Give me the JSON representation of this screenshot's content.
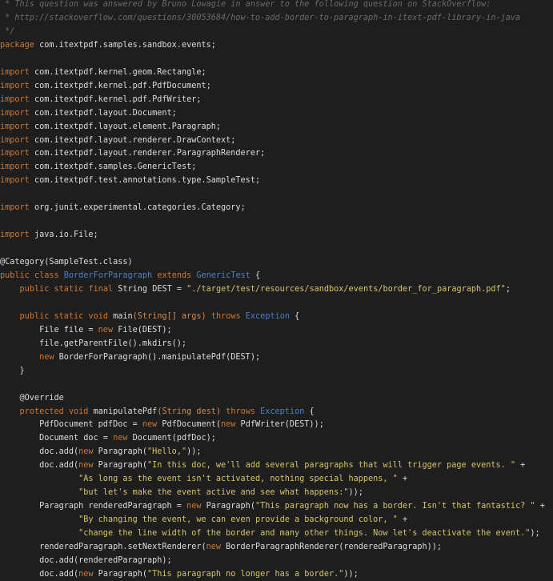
{
  "editor": {
    "lines": [
      [
        {
          "t": " * This question was answered by Bruno Lowagie in answer to the following question on StackOverflow:",
          "k": "cm"
        }
      ],
      [
        {
          "t": " * http://stackoverflow.com/questions/30053684/how-to-add-border-to-paragraph-in-itext-pdf-library-in-java",
          "k": "cm"
        }
      ],
      [
        {
          "t": " */",
          "k": "cm"
        }
      ],
      [
        {
          "t": "package",
          "k": "kw"
        },
        {
          "t": " com.itextpdf.samples.sandbox.events;",
          "k": "tx"
        }
      ],
      [],
      [
        {
          "t": "import",
          "k": "kw"
        },
        {
          "t": " com.itextpdf.kernel.geom.Rectangle;",
          "k": "tx"
        }
      ],
      [
        {
          "t": "import",
          "k": "kw"
        },
        {
          "t": " com.itextpdf.kernel.pdf.PdfDocument;",
          "k": "tx"
        }
      ],
      [
        {
          "t": "import",
          "k": "kw"
        },
        {
          "t": " com.itextpdf.kernel.pdf.PdfWriter;",
          "k": "tx"
        }
      ],
      [
        {
          "t": "import",
          "k": "kw"
        },
        {
          "t": " com.itextpdf.layout.Document;",
          "k": "tx"
        }
      ],
      [
        {
          "t": "import",
          "k": "kw"
        },
        {
          "t": " com.itextpdf.layout.element.Paragraph;",
          "k": "tx"
        }
      ],
      [
        {
          "t": "import",
          "k": "kw"
        },
        {
          "t": " com.itextpdf.layout.renderer.DrawContext;",
          "k": "tx"
        }
      ],
      [
        {
          "t": "import",
          "k": "kw"
        },
        {
          "t": " com.itextpdf.layout.renderer.ParagraphRenderer;",
          "k": "tx"
        }
      ],
      [
        {
          "t": "import",
          "k": "kw"
        },
        {
          "t": " com.itextpdf.samples.GenericTest;",
          "k": "tx"
        }
      ],
      [
        {
          "t": "import",
          "k": "kw"
        },
        {
          "t": " com.itextpdf.test.annotations.type.SampleTest;",
          "k": "tx"
        }
      ],
      [],
      [
        {
          "t": "import",
          "k": "kw"
        },
        {
          "t": " org.junit.experimental.categories.Category;",
          "k": "tx"
        }
      ],
      [],
      [
        {
          "t": "import",
          "k": "kw"
        },
        {
          "t": " java.io.File;",
          "k": "tx"
        }
      ],
      [],
      [
        {
          "t": "@Category(SampleTest.class)",
          "k": "an"
        }
      ],
      [
        {
          "t": "public",
          "k": "kw"
        },
        {
          "t": " ",
          "k": "tx"
        },
        {
          "t": "class",
          "k": "kw"
        },
        {
          "t": " ",
          "k": "tx"
        },
        {
          "t": "BorderForParagraph",
          "k": "ty"
        },
        {
          "t": " ",
          "k": "tx"
        },
        {
          "t": "extends",
          "k": "kw"
        },
        {
          "t": " ",
          "k": "tx"
        },
        {
          "t": "GenericTest",
          "k": "ty"
        },
        {
          "t": " {",
          "k": "tx"
        }
      ],
      [
        {
          "t": "    ",
          "k": "tx"
        },
        {
          "t": "public",
          "k": "kw"
        },
        {
          "t": " ",
          "k": "tx"
        },
        {
          "t": "static",
          "k": "kw"
        },
        {
          "t": " ",
          "k": "tx"
        },
        {
          "t": "final",
          "k": "kw"
        },
        {
          "t": " String DEST = ",
          "k": "tx"
        },
        {
          "t": "\"./target/test/resources/sandbox/events/border_for_paragraph.pdf\"",
          "k": "st"
        },
        {
          "t": ";",
          "k": "tx"
        }
      ],
      [],
      [
        {
          "t": "    ",
          "k": "tx"
        },
        {
          "t": "public",
          "k": "kw"
        },
        {
          "t": " ",
          "k": "tx"
        },
        {
          "t": "static",
          "k": "kw"
        },
        {
          "t": " ",
          "k": "tx"
        },
        {
          "t": "void",
          "k": "kw"
        },
        {
          "t": " main",
          "k": "tx"
        },
        {
          "t": "(String[] args)",
          "k": "pr"
        },
        {
          "t": " ",
          "k": "tx"
        },
        {
          "t": "throws",
          "k": "kw"
        },
        {
          "t": " ",
          "k": "tx"
        },
        {
          "t": "Exception",
          "k": "ty"
        },
        {
          "t": " {",
          "k": "tx"
        }
      ],
      [
        {
          "t": "        File file = ",
          "k": "tx"
        },
        {
          "t": "new",
          "k": "kw"
        },
        {
          "t": " File(DEST);",
          "k": "tx"
        }
      ],
      [
        {
          "t": "        file.getParentFile().mkdirs();",
          "k": "tx"
        }
      ],
      [
        {
          "t": "        ",
          "k": "tx"
        },
        {
          "t": "new",
          "k": "kw"
        },
        {
          "t": " BorderForParagraph().manipulatePdf(DEST);",
          "k": "tx"
        }
      ],
      [
        {
          "t": "    }",
          "k": "tx"
        }
      ],
      [],
      [
        {
          "t": "    @Override",
          "k": "an"
        }
      ],
      [
        {
          "t": "    ",
          "k": "tx"
        },
        {
          "t": "protected",
          "k": "kw"
        },
        {
          "t": " ",
          "k": "tx"
        },
        {
          "t": "void",
          "k": "kw"
        },
        {
          "t": " manipulatePdf",
          "k": "tx"
        },
        {
          "t": "(String dest)",
          "k": "pr"
        },
        {
          "t": " ",
          "k": "tx"
        },
        {
          "t": "throws",
          "k": "kw"
        },
        {
          "t": " ",
          "k": "tx"
        },
        {
          "t": "Exception",
          "k": "ty"
        },
        {
          "t": " {",
          "k": "tx"
        }
      ],
      [
        {
          "t": "        PdfDocument pdfDoc = ",
          "k": "tx"
        },
        {
          "t": "new",
          "k": "kw"
        },
        {
          "t": " PdfDocument(",
          "k": "tx"
        },
        {
          "t": "new",
          "k": "kw"
        },
        {
          "t": " PdfWriter(DEST));",
          "k": "tx"
        }
      ],
      [
        {
          "t": "        Document doc = ",
          "k": "tx"
        },
        {
          "t": "new",
          "k": "kw"
        },
        {
          "t": " Document(pdfDoc);",
          "k": "tx"
        }
      ],
      [
        {
          "t": "        doc.add(",
          "k": "tx"
        },
        {
          "t": "new",
          "k": "kw"
        },
        {
          "t": " Paragraph(",
          "k": "tx"
        },
        {
          "t": "\"Hello,\"",
          "k": "st"
        },
        {
          "t": "));",
          "k": "tx"
        }
      ],
      [
        {
          "t": "        doc.add(",
          "k": "tx"
        },
        {
          "t": "new",
          "k": "kw"
        },
        {
          "t": " Paragraph(",
          "k": "tx"
        },
        {
          "t": "\"In this doc, we'll add several paragraphs that will trigger page events. \"",
          "k": "st"
        },
        {
          "t": " +",
          "k": "tx"
        }
      ],
      [
        {
          "t": "                ",
          "k": "tx"
        },
        {
          "t": "\"As long as the event isn't activated, nothing special happens, \"",
          "k": "st"
        },
        {
          "t": " +",
          "k": "tx"
        }
      ],
      [
        {
          "t": "                ",
          "k": "tx"
        },
        {
          "t": "\"but let's make the event active and see what happens:\"",
          "k": "st"
        },
        {
          "t": "));",
          "k": "tx"
        }
      ],
      [
        {
          "t": "        Paragraph renderedParagraph = ",
          "k": "tx"
        },
        {
          "t": "new",
          "k": "kw"
        },
        {
          "t": " Paragraph(",
          "k": "tx"
        },
        {
          "t": "\"This paragraph now has a border. Isn't that fantastic? \"",
          "k": "st"
        },
        {
          "t": " +",
          "k": "tx"
        }
      ],
      [
        {
          "t": "                ",
          "k": "tx"
        },
        {
          "t": "\"By changing the event, we can even provide a background color, \"",
          "k": "st"
        },
        {
          "t": " +",
          "k": "tx"
        }
      ],
      [
        {
          "t": "                ",
          "k": "tx"
        },
        {
          "t": "\"change the line width of the border and many other things. Now let's deactivate the event.\"",
          "k": "st"
        },
        {
          "t": ");",
          "k": "tx"
        }
      ],
      [
        {
          "t": "        renderedParagraph.setNextRenderer(",
          "k": "tx"
        },
        {
          "t": "new",
          "k": "kw"
        },
        {
          "t": " BorderParagraphRenderer(renderedParagraph));",
          "k": "tx"
        }
      ],
      [
        {
          "t": "        doc.add(renderedParagraph);",
          "k": "tx"
        }
      ],
      [
        {
          "t": "        doc.add(",
          "k": "tx"
        },
        {
          "t": "new",
          "k": "kw"
        },
        {
          "t": " Paragraph(",
          "k": "tx"
        },
        {
          "t": "\"This paragraph no longer has a border.\"",
          "k": "st"
        },
        {
          "t": "));",
          "k": "tx"
        }
      ]
    ]
  },
  "colors": {
    "background": "#1e1e1e",
    "text": "#dcdcdc",
    "comment": "#6a6a6a",
    "keyword": "#cc7832",
    "type": "#4e7fc0",
    "parameter": "#d08a55",
    "string": "#d6c46a"
  }
}
